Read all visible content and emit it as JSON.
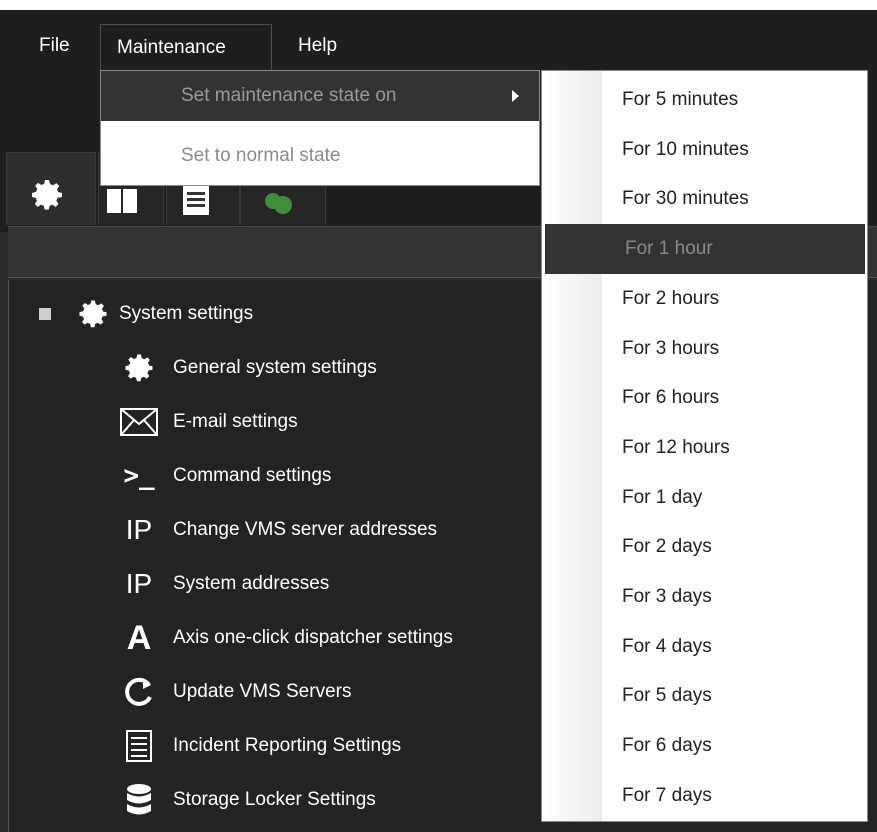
{
  "menubar": {
    "file": "File",
    "maintenance": "Maintenance",
    "help": "Help"
  },
  "maintenance_menu": {
    "set_on": "Set maintenance state on",
    "set_normal": "Set to normal state"
  },
  "flyout": {
    "items": [
      "For 5 minutes",
      "For 10 minutes",
      "For 30 minutes",
      "For 1 hour",
      "For 2 hours",
      "For 3 hours",
      "For 6 hours",
      "For 12 hours",
      "For 1 day",
      "For 2 days",
      "For 3 days",
      "For 4 days",
      "For 5 days",
      "For 6 days",
      "For 7 days"
    ],
    "highlighted": "For 1 hour"
  },
  "tree": {
    "root": "System settings",
    "children": [
      {
        "label": "General system settings",
        "icon": "gear-icon"
      },
      {
        "label": "E-mail settings",
        "icon": "envelope-icon"
      },
      {
        "label": "Command settings",
        "icon": "terminal-icon"
      },
      {
        "label": "Change VMS server addresses",
        "icon": "ip-icon"
      },
      {
        "label": "System addresses",
        "icon": "ip-icon"
      },
      {
        "label": "Axis one-click dispatcher settings",
        "icon": "axis-icon"
      },
      {
        "label": "Update VMS Servers",
        "icon": "refresh-icon"
      },
      {
        "label": "Incident Reporting Settings",
        "icon": "list-icon"
      },
      {
        "label": "Storage Locker Settings",
        "icon": "database-icon"
      }
    ]
  }
}
